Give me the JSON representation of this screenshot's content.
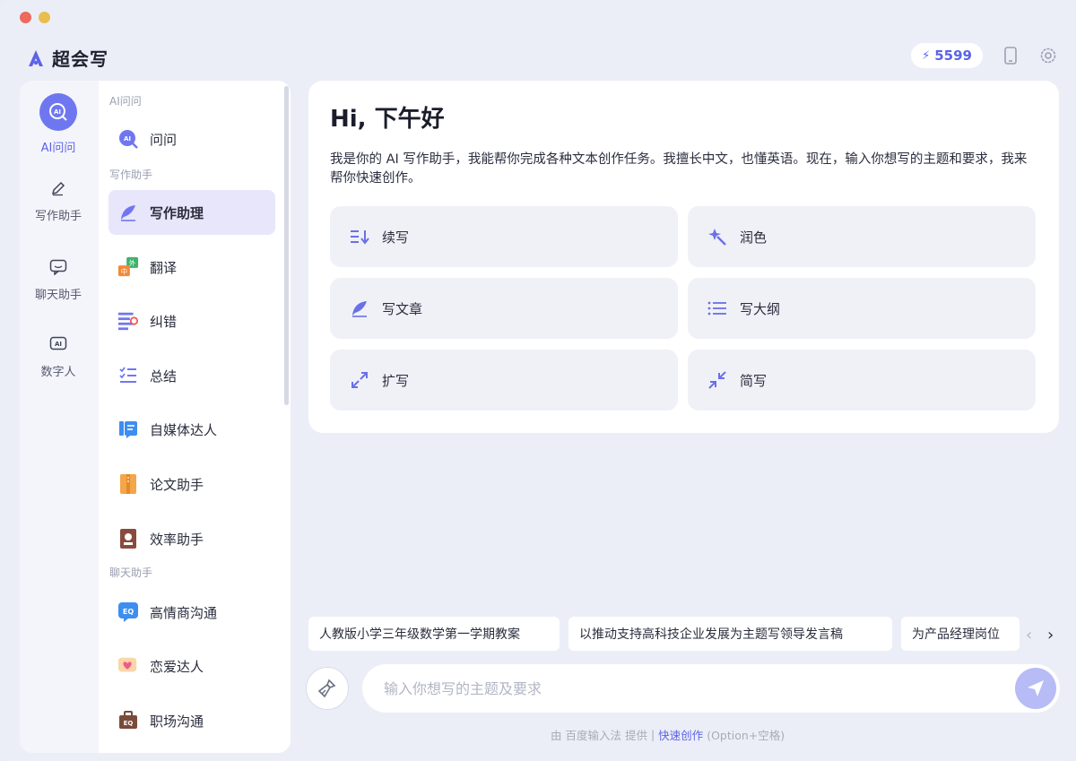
{
  "app": {
    "name": "超会写",
    "credits": "5599"
  },
  "rail": [
    {
      "label": "AI问问",
      "icon": "ai-ask-icon",
      "active": true
    },
    {
      "label": "写作助手",
      "icon": "pen-icon"
    },
    {
      "label": "聊天助手",
      "icon": "chat-icon"
    },
    {
      "label": "数字人",
      "icon": "digital-human-icon"
    }
  ],
  "menu": {
    "section_ai": "AI问问",
    "section_write": "写作助手",
    "section_chat": "聊天助手",
    "items": [
      {
        "label": "问问"
      },
      {
        "label": "写作助理"
      },
      {
        "label": "翻译"
      },
      {
        "label": "纠错"
      },
      {
        "label": "总结"
      },
      {
        "label": "自媒体达人"
      },
      {
        "label": "论文助手"
      },
      {
        "label": "效率助手"
      },
      {
        "label": "高情商沟通"
      },
      {
        "label": "恋爱达人"
      },
      {
        "label": "职场沟通"
      }
    ]
  },
  "main": {
    "greeting": "Hi, 下午好",
    "intro": "我是你的 AI 写作助手，我能帮你完成各种文本创作任务。我擅长中文，也懂英语。现在，输入你想写的主题和要求，我来帮你快速创作。",
    "actions": [
      {
        "label": "续写"
      },
      {
        "label": "润色"
      },
      {
        "label": "写文章"
      },
      {
        "label": "写大纲"
      },
      {
        "label": "扩写"
      },
      {
        "label": "简写"
      }
    ]
  },
  "suggestions": [
    "人教版小学三年级数学第一学期教案",
    "以推动支持高科技企业发展为主题写领导发言稿",
    "为产品经理岗位"
  ],
  "input": {
    "placeholder": "输入你想写的主题及要求"
  },
  "footer": {
    "prefix": "由 百度输入法 提供",
    "sep": "|",
    "link": "快速创作",
    "shortcut": "(Option+空格)"
  },
  "colors": {
    "accent": "#5b63e8",
    "active_bg": "#e8e6fb",
    "window_bg": "#eceef7"
  }
}
